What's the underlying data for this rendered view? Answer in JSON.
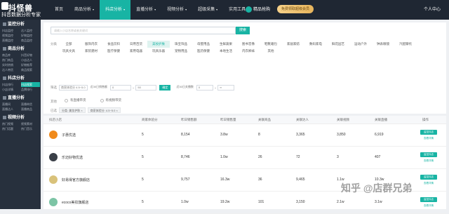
{
  "brand": {
    "name": "抖怪兽",
    "slogan": "抖音数据分析专家"
  },
  "nav": [
    {
      "label": "首页",
      "caret": ""
    },
    {
      "label": "商品分析",
      "caret": "▾"
    },
    {
      "label": "抖店分析",
      "caret": "▾"
    },
    {
      "label": "直播分析",
      "caret": "▾"
    },
    {
      "label": "视频分析",
      "caret": "▾"
    },
    {
      "label": "超级采集",
      "caret": "▾"
    },
    {
      "label": "实用工具",
      "caret": "▾"
    }
  ],
  "nav_active": 2,
  "goods_btn": "精品抢购",
  "vip_btn": "免费领取超级会员",
  "user": "个人中心",
  "sidebar": [
    {
      "head": "监控分析",
      "items": [
        "抖店监控",
        "达人监控",
        "视频监控",
        "好物监控",
        "直播监控",
        "商品监控"
      ]
    },
    {
      "head": "商品分析",
      "items": [
        "商品库",
        "抖音好物",
        "热门商品",
        "小店达人",
        "实时热销",
        "好物推荐",
        "达人带货",
        "商品搜索"
      ]
    },
    {
      "head": "抖店分析",
      "items": [
        "抖店排行",
        "抖店搜索",
        "小店详情",
        "品牌排行"
      ],
      "active": 1
    },
    {
      "head": "直播分析",
      "items": [
        "直播间",
        "直播带货",
        "直播达人",
        "直播商品"
      ]
    },
    {
      "head": "视频分析",
      "items": [
        "热门视频",
        "视频素材",
        "热门话题",
        "热门音乐"
      ]
    }
  ],
  "search": {
    "placeholder": "请输入小店名称或者关键词",
    "button": "搜索"
  },
  "labels": {
    "category": "分类",
    "filter": "筛选",
    "other": "其他",
    "selected": "已选"
  },
  "categories": [
    "全部",
    "服饰内衣",
    "食品饮料",
    "日用百货",
    "美妆护肤",
    "珠宝饰品",
    "母婴用品",
    "生鲜蔬果",
    "图书音像",
    "鞋靴箱包",
    "家居家纺",
    "数码家电",
    "鲜花园艺",
    "运动户外",
    "钟表眼镜",
    "汽配摩托",
    "玩具文具",
    "家装建材",
    "医疗保健",
    "家用电器",
    "玩具乐器",
    "宠物用品",
    "医药保健",
    "本地生活",
    "内衣裤袜",
    "其他"
  ],
  "category_active": 4,
  "filters": {
    "score_label": "商家体验分",
    "score_value": "4.5~5.0",
    "sales_label": "近30日销售额",
    "sales_from": "0",
    "sales_to": "50",
    "confirm": "确定",
    "fans_label": "近30日关播数",
    "fans_from": "0",
    "fans_to": "∞"
  },
  "radios": [
    "有直播带货",
    "有视频带货"
  ],
  "tags": [
    "分类: 美妆护肤 ×",
    "商家体验分: 4.5~5.0 ×"
  ],
  "table": {
    "headers": [
      "抖店小店",
      "商家体验分",
      "昨日销售额",
      "昨日销售量",
      "关联商品",
      "关联商品数",
      "关联达人",
      "关联视频",
      "关联直播",
      "操作"
    ],
    "rows": [
      {
        "name": "子惠优选",
        "score": "5",
        "sales": "8,154",
        "volume": "3.8w",
        "goods": "8",
        "goods_count": "",
        "talents": "3,365",
        "videos": "3,850",
        "lives": "6,919",
        "btn": "监控抖店",
        "link": "查看详情",
        "avatar": "#f08a1b"
      },
      {
        "name": "乐迈好物优选",
        "score": "5",
        "sales": "8,746",
        "volume": "1.0w",
        "goods": "26",
        "goods_count": "",
        "talents": "72",
        "videos": "3",
        "lives": "407",
        "btn": "监控抖店",
        "link": "查看详情",
        "avatar": "#3a3f47"
      },
      {
        "name": "好易得官方旗舰店",
        "score": "5",
        "sales": "9,757",
        "volume": "16.3w",
        "goods": "36",
        "goods_count": "",
        "talents": "9,465",
        "videos": "1.1w",
        "lives": "10.3w",
        "btn": "监控抖店",
        "link": "查看详情",
        "avatar": "#d9c27a"
      },
      {
        "name": "ecoco美妆旗舰店",
        "score": "5",
        "sales": "1.0w",
        "volume": "19.2w",
        "goods": "101",
        "goods_count": "",
        "talents": "3,150",
        "videos": "2.1w",
        "lives": "3.1w",
        "btn": "监控抖店",
        "link": "查看详情",
        "avatar": "#7cc4a5"
      }
    ]
  },
  "watermark": "知乎 @店群兄弟"
}
